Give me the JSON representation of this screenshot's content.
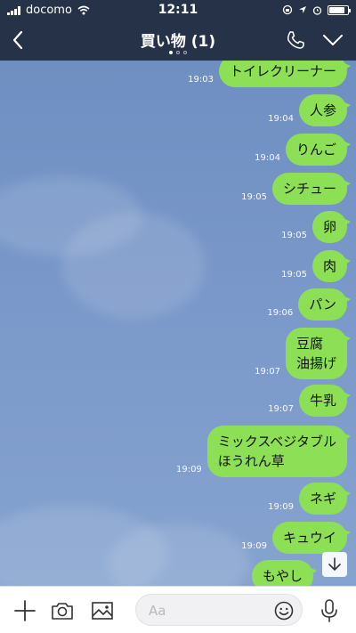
{
  "status_bar": {
    "carrier": "docomo",
    "time": "12:11"
  },
  "header": {
    "title": "買い物 (1)"
  },
  "messages": [
    {
      "text": "トイレクリーナー",
      "time": "19:03"
    },
    {
      "text": "人参",
      "time": "19:04"
    },
    {
      "text": "りんご",
      "time": "19:04"
    },
    {
      "text": "シチュー",
      "time": "19:05"
    },
    {
      "text": "卵",
      "time": "19:05"
    },
    {
      "text": "肉",
      "time": "19:05"
    },
    {
      "text": "パン",
      "time": "19:06"
    },
    {
      "line1": "豆腐",
      "line2": "油揚げ",
      "time": "19:07"
    },
    {
      "text": "牛乳",
      "time": "19:07"
    },
    {
      "line1": "ミックスベジタブル",
      "line2": "ほうれん草",
      "time": "19:09"
    },
    {
      "text": "ネギ",
      "time": "19:09"
    },
    {
      "text": "キュウイ",
      "time": "19:09"
    },
    {
      "text": "もやし"
    }
  ],
  "input": {
    "placeholder": "Aa"
  },
  "icons": {
    "back": "chevron-left-icon",
    "phone": "phone-icon",
    "menu": "chevron-down-icon",
    "plus": "plus-icon",
    "camera": "camera-icon",
    "image": "image-icon",
    "emoji": "emoji-icon",
    "mic": "microphone-icon",
    "scroll": "arrow-down-icon"
  },
  "colors": {
    "bubble": "#8de055",
    "header": "#263248"
  }
}
